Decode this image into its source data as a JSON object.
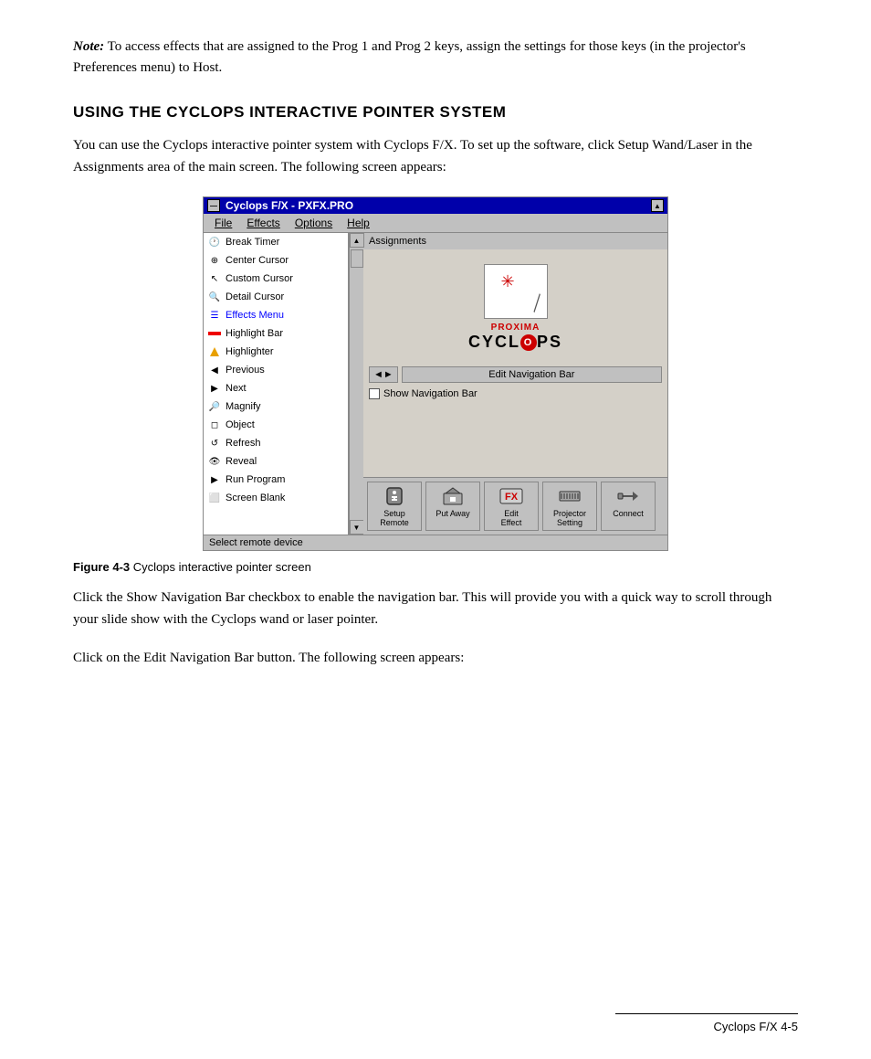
{
  "note": {
    "label": "Note:",
    "text": "  To access effects that are assigned to the Prog 1 and Prog 2 keys, assign the settings for those keys (in the projector's Preferences menu) to Host."
  },
  "section": {
    "heading": "USING THE CYCLOPS INTERACTIVE POINTER SYSTEM",
    "body1": "You can use the Cyclops interactive pointer system with Cyclops F/X. To set up the software, click Setup Wand/Laser in the Assignments area of the main screen. The following screen appears:",
    "body2": "Click the Show Navigation Bar checkbox to enable the navigation bar. This will provide you with a quick way to scroll through your slide show with the Cyclops wand or laser pointer.",
    "body3": "Click on the Edit Navigation Bar button. The following screen appears:"
  },
  "screenshot": {
    "title": "Cyclops F/X - PXFX.PRO",
    "menu_items": [
      "File",
      "Effects",
      "Options",
      "Help"
    ],
    "list_items": [
      {
        "label": "Break Timer",
        "icon": "clock"
      },
      {
        "label": "Center Cursor",
        "icon": "cursor"
      },
      {
        "label": "Custom Cursor",
        "icon": "cursor-custom"
      },
      {
        "label": "Detail Cursor",
        "icon": "cursor-detail"
      },
      {
        "label": "Effects Menu",
        "icon": "effects",
        "special": "effects-menu"
      },
      {
        "label": "Highlight Bar",
        "icon": "highlight-bar"
      },
      {
        "label": "Highlighter",
        "icon": "highlighter"
      },
      {
        "label": "Previous",
        "icon": "previous"
      },
      {
        "label": "Next",
        "icon": "next"
      },
      {
        "label": "Magnify",
        "icon": "magnify"
      },
      {
        "label": "Object",
        "icon": "object"
      },
      {
        "label": "Refresh",
        "icon": "refresh"
      },
      {
        "label": "Reveal",
        "icon": "reveal"
      },
      {
        "label": "Run Program",
        "icon": "run"
      },
      {
        "label": "Screen Blank",
        "icon": "screen"
      }
    ],
    "assignments_label": "Assignments",
    "proxima_text": "PROXIMA",
    "cyclops_text": "CYCL",
    "cyclops_o": "O",
    "cyclops_ps": "PS",
    "edit_nav_btn": "Edit Navigation Bar",
    "nav_arrows": "◄►",
    "show_nav_label": "Show Navigation Bar",
    "toolbar_buttons": [
      {
        "label": "Setup\nRemote",
        "icon": "remote"
      },
      {
        "label": "Put Away",
        "icon": "put-away"
      },
      {
        "label": "Edit\nEffect",
        "icon": "fx"
      },
      {
        "label": "Projector\nSetting",
        "icon": "projector"
      },
      {
        "label": "Connect",
        "icon": "connect"
      }
    ],
    "statusbar": "Select remote device"
  },
  "figure": {
    "label": "Figure 4-3",
    "caption": "  Cyclops interactive pointer screen"
  },
  "footer": {
    "text": "Cyclops F/X    4-5"
  }
}
